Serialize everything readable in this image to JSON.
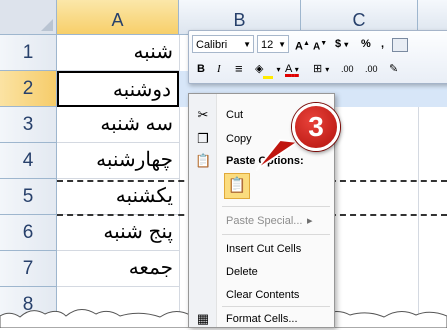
{
  "columns": [
    "A",
    "B",
    "C"
  ],
  "rows": [
    {
      "num": "1",
      "value": "شنبه"
    },
    {
      "num": "2",
      "value": "دوشنبه"
    },
    {
      "num": "3",
      "value": "سه شنبه"
    },
    {
      "num": "4",
      "value": "چهارشنبه"
    },
    {
      "num": "5",
      "value": "یکشنبه"
    },
    {
      "num": "6",
      "value": "پنج شنبه"
    },
    {
      "num": "7",
      "value": "جمعه"
    },
    {
      "num": "8",
      "value": ""
    }
  ],
  "mini_toolbar": {
    "font_name": "Calibri",
    "font_size": "12",
    "grow_font": "A",
    "shrink_font": "A",
    "currency": "$",
    "percent": "%",
    "comma": ",",
    "bold": "B",
    "italic": "I",
    "font_color": "A",
    "increase_decimal": ".00",
    "decrease_decimal": ".00"
  },
  "context_menu": {
    "cut": "Cut",
    "copy": "Copy",
    "paste_options": "Paste Options:",
    "paste_special": "Paste Special...",
    "insert_cut_cells": "Insert Cut Cells",
    "delete": "Delete",
    "clear_contents": "Clear Contents",
    "format_cells": "Format Cells..."
  },
  "step_badge": "3",
  "colors": {
    "accent": "#c0160f",
    "selection": "#d7e6f8",
    "header_selected": "#f7cf6a"
  }
}
